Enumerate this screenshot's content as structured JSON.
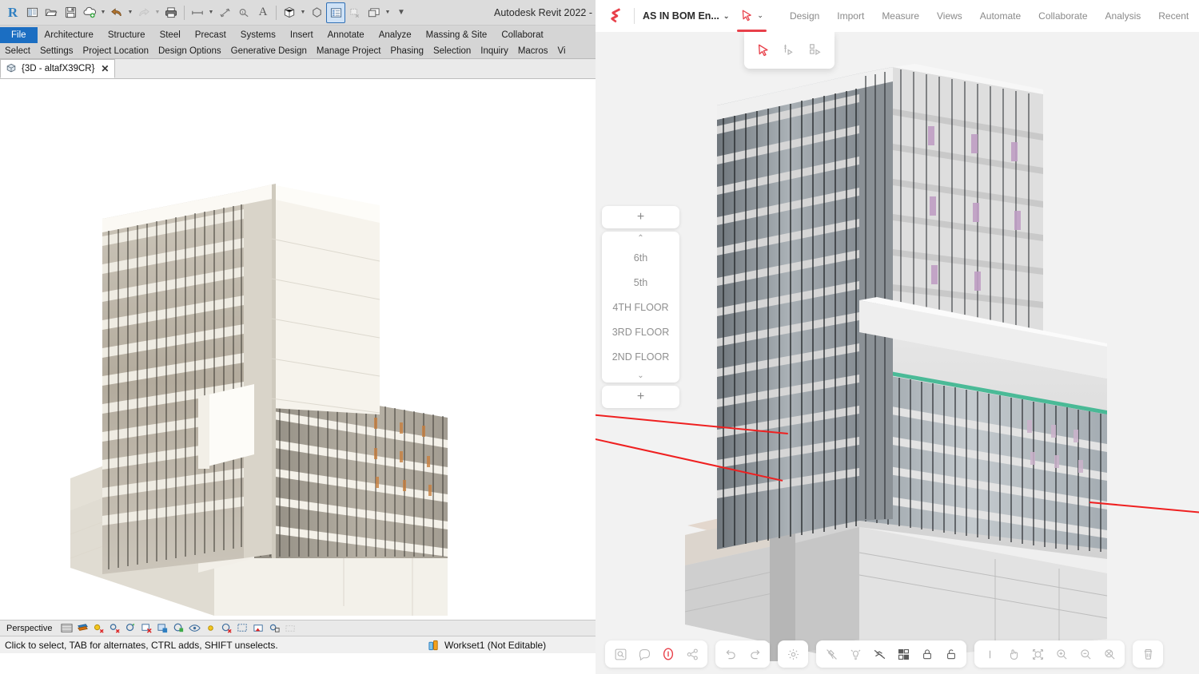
{
  "revit": {
    "title": "Autodesk Revit 2022 -",
    "quick_access": [
      {
        "name": "revit-logo-icon",
        "label": "R"
      },
      {
        "name": "new-project-icon",
        "label": "New"
      },
      {
        "name": "open-project-icon",
        "label": "Open"
      },
      {
        "name": "save-icon",
        "label": "Save"
      },
      {
        "name": "save-to-cloud-icon",
        "label": "Save As Cloud Model"
      },
      {
        "name": "undo-icon",
        "label": "Undo"
      },
      {
        "name": "redo-icon",
        "label": "Redo"
      },
      {
        "name": "print-icon",
        "label": "Print"
      },
      {
        "name": "measure-icon",
        "label": "Measure"
      },
      {
        "name": "aligned-dimension-icon",
        "label": "Aligned Dimension"
      },
      {
        "name": "tag-icon",
        "label": "Tag by Category"
      },
      {
        "name": "text-icon",
        "label": "Text"
      },
      {
        "name": "default-3d-view-icon",
        "label": "Default 3D View"
      },
      {
        "name": "section-icon",
        "label": "Section"
      },
      {
        "name": "properties-icon",
        "label": "Properties"
      },
      {
        "name": "close-hidden-windows-icon",
        "label": "Close Hidden Windows"
      },
      {
        "name": "switch-windows-icon",
        "label": "Switch Windows"
      },
      {
        "name": "customize-qat-icon",
        "label": "Customize Quick Access Toolbar"
      }
    ],
    "ribbon_tabs": [
      "File",
      "Architecture",
      "Structure",
      "Steel",
      "Precast",
      "Systems",
      "Insert",
      "Annotate",
      "Analyze",
      "Massing & Site",
      "Collaborat"
    ],
    "ribbon_subtabs": [
      "Select",
      "Settings",
      "Project Location",
      "Design Options",
      "Generative Design",
      "Manage Project",
      "Phasing",
      "Selection",
      "Inquiry",
      "Macros",
      "Vi"
    ],
    "view_tab": {
      "label": "{3D - altafX39CR}",
      "close": "✕"
    },
    "view_control_bar": {
      "scale_label": "Perspective",
      "icons": [
        "model-graphics-style-icon",
        "visual-style-icon",
        "sun-path-icon",
        "shadows-icon",
        "render-icon",
        "crop-view-icon",
        "crop-region-visible-icon",
        "lock-3d-view-icon",
        "temporary-hide-isolate-icon",
        "reveal-hidden-elements-icon",
        "temporary-view-properties-icon",
        "hide-analytical-model-icon",
        "reveal-constraints-icon",
        "worksharing-display-icon",
        "disabled-icon"
      ]
    },
    "status_bar": {
      "message": "Click to select, TAB for alternates, CTRL adds, SHIFT unselects.",
      "workset_icon": "worksets-icon",
      "workset": "Workset1 (Not Editable)"
    }
  },
  "viewer": {
    "logo_name": "speckle-logo-icon",
    "project": {
      "label": "AS IN BOM En...",
      "caret": "⌄"
    },
    "active_tool": {
      "name": "cursor-select-tool",
      "caret": "⌄"
    },
    "nav": [
      "Design",
      "Import",
      "Measure",
      "Views",
      "Automate",
      "Collaborate",
      "Analysis",
      "Recent"
    ],
    "tool_flyout": [
      {
        "name": "select-cursor-tool-icon",
        "active": true
      },
      {
        "name": "section-tool-icon",
        "active": false
      },
      {
        "name": "box-select-tool-icon",
        "active": false
      }
    ],
    "floor_selector": {
      "add_top": "+",
      "chevron_up": "⌃",
      "levels": [
        "6th",
        "5th",
        "4TH FLOOR",
        "3RD FLOOR",
        "2ND FLOOR"
      ],
      "chevron_down": "⌄",
      "add_bottom": "+"
    },
    "bottom_toolbar": {
      "groups": [
        {
          "name": "view-tools-group",
          "buttons": [
            {
              "name": "zoom-to-selection-icon",
              "accent": false
            },
            {
              "name": "comment-icon",
              "accent": false
            },
            {
              "name": "info-icon",
              "accent": true
            },
            {
              "name": "share-icon",
              "accent": false
            }
          ]
        },
        {
          "name": "history-group",
          "buttons": [
            {
              "name": "undo-icon",
              "accent": false
            },
            {
              "name": "redo-icon",
              "accent": false
            }
          ]
        },
        {
          "name": "settings-group",
          "buttons": [
            {
              "name": "settings-gear-icon",
              "accent": false
            }
          ]
        },
        {
          "name": "display-group",
          "buttons": [
            {
              "name": "projection-off-icon",
              "accent": false
            },
            {
              "name": "lighting-icon",
              "accent": false
            },
            {
              "name": "explode-icon",
              "accent": false
            },
            {
              "name": "filters-icon",
              "accent": false
            },
            {
              "name": "lock-icon",
              "accent": false
            },
            {
              "name": "unlock-icon",
              "accent": false
            }
          ]
        },
        {
          "name": "navigation-group",
          "buttons": [
            {
              "name": "cursor-icon",
              "accent": false
            },
            {
              "name": "pan-hand-icon",
              "accent": false
            },
            {
              "name": "zoom-extents-icon",
              "accent": false
            },
            {
              "name": "zoom-in-icon",
              "accent": false
            },
            {
              "name": "zoom-out-icon",
              "accent": false
            },
            {
              "name": "zoom-window-icon",
              "accent": false
            }
          ]
        },
        {
          "name": "delete-group",
          "buttons": [
            {
              "name": "trash-icon",
              "accent": false
            }
          ]
        }
      ]
    },
    "colors": {
      "accent": "#e8404a",
      "section_plane": "#2fb38a",
      "measure_line": "#ef2020",
      "canvas_bg": "#f2f2f2"
    }
  }
}
